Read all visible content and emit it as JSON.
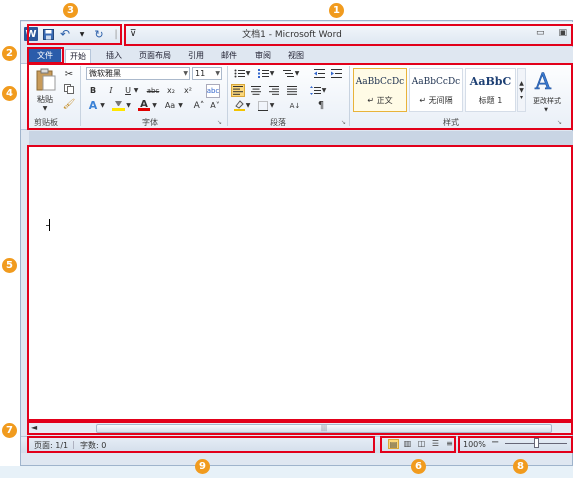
{
  "window": {
    "title": "文档1 - Microsoft Word",
    "minimize_glyph": "▭",
    "restore_glyph": "▣"
  },
  "quick_access": {
    "word_icon": "W",
    "icons": [
      "word-icon",
      "save-icon",
      "undo-icon",
      "redo-icon",
      "customize-icon"
    ],
    "undo_glyph": "↶",
    "redo_glyph": "↻",
    "sep_glyph": "|",
    "customize_glyph": "⊽"
  },
  "tabs": {
    "file": "文件",
    "home": "开始",
    "insert": "插入",
    "layout": "页面布局",
    "references": "引用",
    "mailings": "邮件",
    "review": "审阅",
    "view": "视图"
  },
  "clipboard": {
    "paste": "粘贴",
    "group": "剪贴板"
  },
  "font": {
    "name": "微软雅黑",
    "size": "11",
    "group": "字体",
    "bold": "B",
    "italic": "I",
    "underline": "U",
    "strike": "abc",
    "subscript": "x₂",
    "superscript": "x²",
    "grow": "A˄",
    "shrink": "A˅",
    "change_case": "Aa",
    "font_color": "A",
    "clear": "A"
  },
  "paragraph": {
    "group": "段落",
    "sort": "A↓",
    "pilcrow": "¶"
  },
  "styles": {
    "group": "样式",
    "items": [
      {
        "preview": "AaBbCcDc",
        "name": "↵ 正文"
      },
      {
        "preview": "AaBbCcDc",
        "name": "↵ 无间隔"
      },
      {
        "preview": "AaBbC",
        "name": "标题 1"
      }
    ],
    "change": "更改样式"
  },
  "scrollbar": {
    "left": "◄",
    "grip": "|||"
  },
  "statusbar": {
    "page": "页面: 1/1",
    "words": "字数: 0",
    "zoom": "100%",
    "zoom_minus": "−"
  },
  "badges": [
    "1",
    "2",
    "3",
    "4",
    "5",
    "6",
    "7",
    "8",
    "9"
  ],
  "colors": {
    "file_tab": "#2a5caa",
    "annotation_red": "#e2001a",
    "badge_orange": "#f19b1e",
    "word_blue": "#2b579a"
  }
}
